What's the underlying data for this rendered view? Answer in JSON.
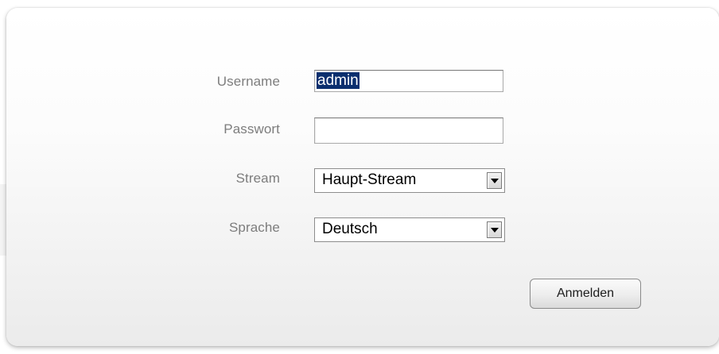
{
  "login_form": {
    "username_label": "Username",
    "username_value": "admin",
    "password_label": "Passwort",
    "password_value": "",
    "stream_label": "Stream",
    "stream_value": "Haupt-Stream",
    "language_label": "Sprache",
    "language_value": "Deutsch",
    "submit_label": "Anmelden"
  },
  "icons": {
    "dropdown": "chevron-down-icon"
  },
  "colors": {
    "label_text": "#7d7d7d",
    "selection_highlight": "#0b2f6e"
  }
}
